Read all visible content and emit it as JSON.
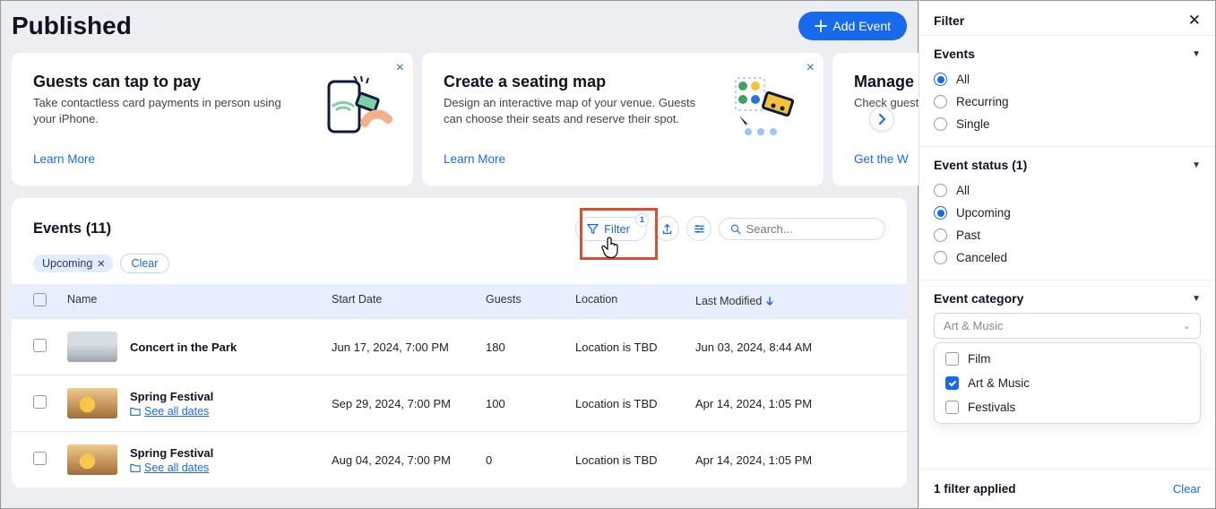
{
  "pageTitle": "Published",
  "addEventLabel": "Add Event",
  "cards": [
    {
      "title": "Guests can tap to pay",
      "desc": "Take contactless card payments in person using your iPhone.",
      "cta": "Learn More"
    },
    {
      "title": "Create a seating map",
      "desc": "Design an interactive map of your venue. Guests can choose their seats and reserve their spot.",
      "cta": "Learn More"
    },
    {
      "title": "Manage",
      "desc": "Check guest attendance.",
      "cta": "Get the W"
    }
  ],
  "eventsHeader": "Events (11)",
  "filterBtn": {
    "label": "Filter",
    "badge": "1"
  },
  "search": {
    "placeholder": "Search..."
  },
  "activeChip": {
    "label": "Upcoming"
  },
  "clearChip": "Clear",
  "columns": {
    "name": "Name",
    "start": "Start Date",
    "guests": "Guests",
    "location": "Location",
    "modified": "Last Modified"
  },
  "seeAll": "See all dates",
  "rows": [
    {
      "name": "Concert in the Park",
      "start": "Jun 17, 2024, 7:00 PM",
      "guests": "180",
      "location": "Location is TBD",
      "modified": "Jun 03, 2024, 8:44 AM",
      "recurring": false,
      "thumb": "concert"
    },
    {
      "name": "Spring Festival",
      "start": "Sep 29, 2024, 7:00 PM",
      "guests": "100",
      "location": "Location is TBD",
      "modified": "Apr 14, 2024, 1:05 PM",
      "recurring": true,
      "thumb": "spring"
    },
    {
      "name": "Spring Festival",
      "start": "Aug 04, 2024, 7:00 PM",
      "guests": "0",
      "location": "Location is TBD",
      "modified": "Apr 14, 2024, 1:05 PM",
      "recurring": true,
      "thumb": "spring"
    }
  ],
  "filterPanel": {
    "title": "Filter",
    "sections": {
      "events": {
        "label": "Events",
        "options": [
          "All",
          "Recurring",
          "Single"
        ],
        "selected": "All"
      },
      "status": {
        "label": "Event status (1)",
        "options": [
          "All",
          "Upcoming",
          "Past",
          "Canceled"
        ],
        "selected": "Upcoming"
      },
      "category": {
        "label": "Event category",
        "placeholder": "Art & Music",
        "options": [
          {
            "label": "Film",
            "checked": false
          },
          {
            "label": "Art & Music",
            "checked": true
          },
          {
            "label": "Festivals",
            "checked": false
          }
        ]
      }
    },
    "footer": {
      "applied": "1 filter applied",
      "clear": "Clear"
    }
  }
}
